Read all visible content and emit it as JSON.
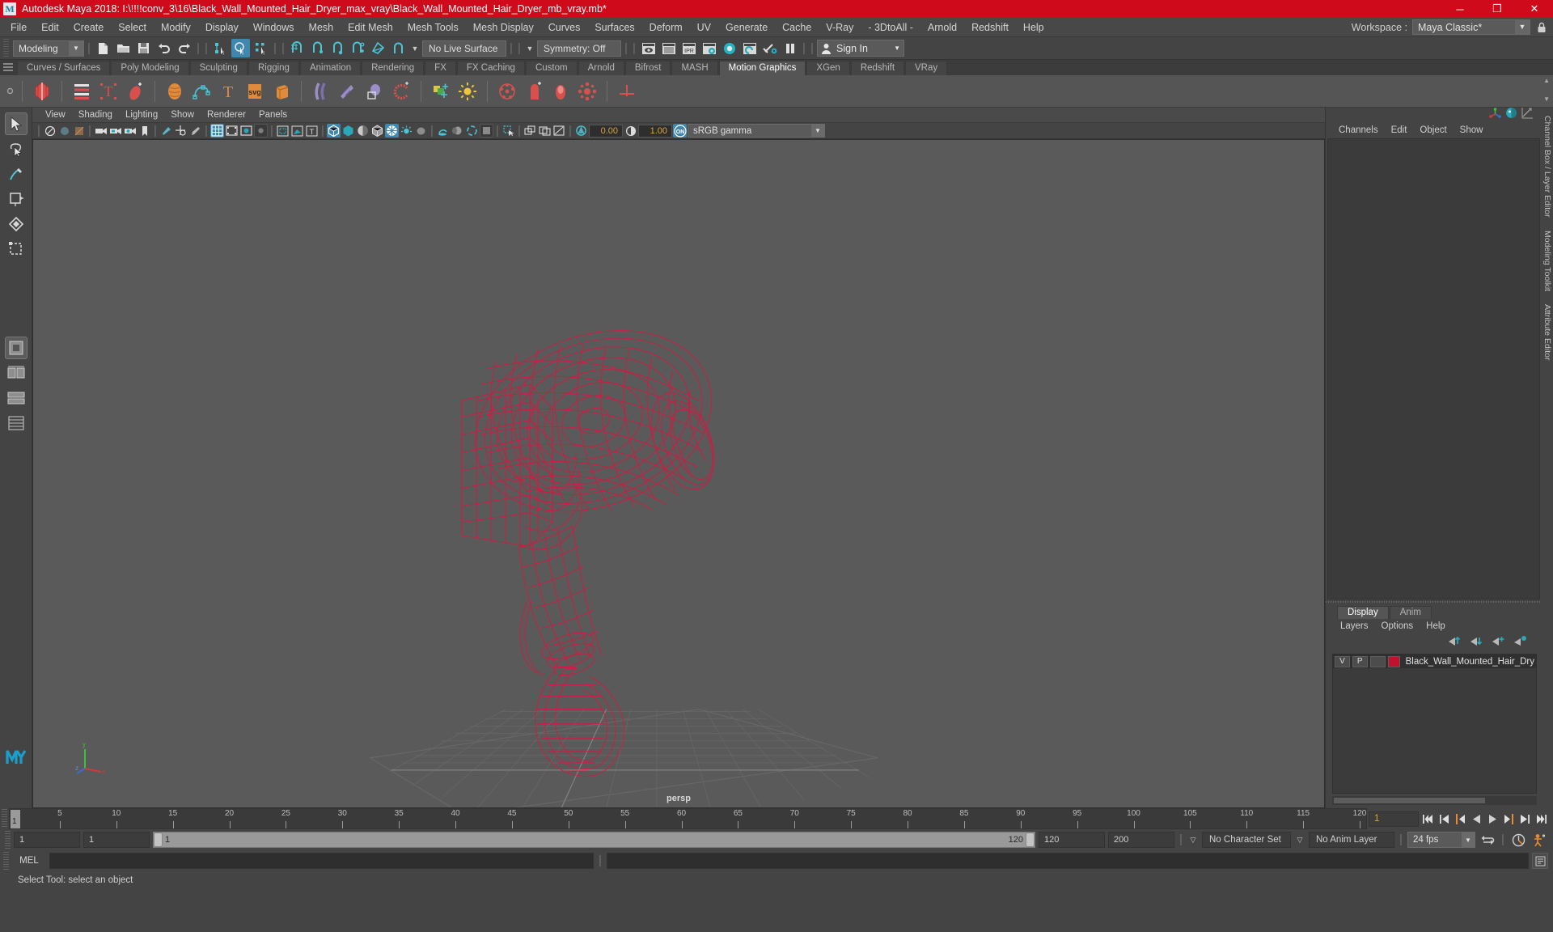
{
  "window": {
    "title": "Autodesk Maya 2018: I:\\!!!!conv_3\\16\\Black_Wall_Mounted_Hair_Dryer_max_vray\\Black_Wall_Mounted_Hair_Dryer_mb_vray.mb*",
    "logo": "M",
    "minimize": "─",
    "maximize": "❐",
    "close": "✕",
    "titlebar_color": "#cf0a1a"
  },
  "menubar": {
    "items": [
      "File",
      "Edit",
      "Create",
      "Select",
      "Modify",
      "Display",
      "Windows",
      "Mesh",
      "Edit Mesh",
      "Mesh Tools",
      "Mesh Display",
      "Curves",
      "Surfaces",
      "Deform",
      "UV",
      "Generate",
      "Cache",
      "V-Ray",
      "- 3DtoAll -",
      "Arnold",
      "Redshift",
      "Help"
    ],
    "workspace_label": "Workspace :",
    "workspace_value": "Maya Classic*",
    "lock_icon": "lock-icon"
  },
  "statusbar": {
    "menuset": "Modeling",
    "file_icons": [
      "new-scene-icon",
      "open-scene-icon",
      "save-scene-icon",
      "undo-icon",
      "redo-icon"
    ],
    "select_mode_icons": [
      "select-by-hierarchy-icon",
      "select-by-object-icon",
      "select-by-component-icon"
    ],
    "snap_icons": [
      "snap-to-grid-icon",
      "snap-to-curve-icon",
      "snap-to-point-icon",
      "snap-to-projected-center-icon",
      "snap-to-view-plane-icon",
      "make-live-icon"
    ],
    "live_surface": "No Live Surface",
    "symmetry": "Symmetry: Off",
    "render_icons": [
      "render-current-frame-icon",
      "ipr-render-icon",
      "render-settings-icon",
      "hypershade-icon",
      "render-view-icon",
      "render-sequence-icon",
      "pause-render-icon"
    ],
    "signin_label": "Sign In",
    "signin_icon": "user-icon"
  },
  "shelf": {
    "tabs": [
      "Curves / Surfaces",
      "Poly Modeling",
      "Sculpting",
      "Rigging",
      "Animation",
      "Rendering",
      "FX",
      "FX Caching",
      "Custom",
      "Arnold",
      "Bifrost",
      "MASH",
      "Motion Graphics",
      "XGen",
      "Redshift",
      "VRay"
    ],
    "active_tab": "Motion Graphics",
    "icons": [
      "mash-network-icon",
      "mash-menu-icon",
      "mash-text-icon",
      "mash-trails-icon",
      "mash-volume-icon",
      "mash-curve-icon",
      "mash-type-icon",
      "svg-icon",
      "mash-extrude-icon",
      "mash-dynamics-icon",
      "mash-flight-icon",
      "mash-orient-icon",
      "mash-curl-icon",
      "mash-color-icon",
      "mash-world-icon",
      "mash-replicator-icon",
      "mash-distribute-icon",
      "mash-merge-icon",
      "mash-explode-icon",
      "mash-align-icon"
    ]
  },
  "toolbox": {
    "tools": [
      "select-tool",
      "lasso-select-tool",
      "paint-select-tool",
      "move-tool",
      "rotate-tool",
      "scale-tool"
    ],
    "layout_tools": [
      "single-pane-layout-icon",
      "two-pane-layout-icon",
      "three-pane-layout-icon",
      "four-pane-layout-icon"
    ],
    "app_logo": "M"
  },
  "viewport": {
    "menus": [
      "View",
      "Shading",
      "Lighting",
      "Show",
      "Renderer",
      "Panels"
    ],
    "toolbar_icons": [
      "select-camera-icon",
      "lock-camera-icon",
      "camera-attributes-icon",
      "bookmark-icon",
      "image-plane-icon",
      "two-d-pan-zoom-icon",
      "grease-pencil-icon",
      "grid-icon",
      "film-gate-icon",
      "resolution-gate-icon",
      "gate-mask-icon",
      "xray-icon",
      "xray-joints-icon",
      "texture-icon",
      "wireframe-icon",
      "smooth-shade-icon",
      "flat-shade-icon",
      "wireframe-on-shaded-icon",
      "textured-icon",
      "use-default-light-icon",
      "shadows-icon",
      "screen-space-ao-icon",
      "motion-blur-icon",
      "multisample-aa-icon",
      "depth-of-field-icon",
      "isolate-select-icon",
      "display-layer-icon",
      "panel-zoom-icon",
      "exposure-icon"
    ],
    "exposure_value": "0.00",
    "gamma_value": "1.00",
    "color_management": "sRGB gamma",
    "color_mgmt_toggle": "ON",
    "camera_label": "persp",
    "axis_labels": [
      "y",
      "x",
      "z"
    ],
    "object_color": "#e0133f",
    "bg_color": "#5a5a5a"
  },
  "right_panel": {
    "quick_icons": [
      "axis-gizmo-icon",
      "render-globals-icon",
      "graph-editor-icon"
    ],
    "menus": [
      "Channels",
      "Edit",
      "Object",
      "Show"
    ],
    "vertical_tabs": [
      "Channel Box / Layer Editor",
      "Modeling Toolkit",
      "Attribute Editor"
    ]
  },
  "layer_editor": {
    "tabs": [
      "Display",
      "Anim"
    ],
    "active_tab": "Display",
    "menus": [
      "Layers",
      "Options",
      "Help"
    ],
    "buttons": [
      "move-layer-up-icon",
      "move-layer-down-icon",
      "new-layer-icon",
      "new-layer-from-selected-icon"
    ],
    "layers": [
      {
        "visibility": "V",
        "playback": "P",
        "shading": "",
        "color": "#c0112e",
        "name": "Black_Wall_Mounted_Hair_Dry"
      }
    ]
  },
  "timeslider": {
    "current_frame_left": "1",
    "start_frame": "1",
    "cursor_frame": "1",
    "ticks": [
      5,
      10,
      15,
      20,
      25,
      30,
      35,
      40,
      45,
      50,
      55,
      60,
      65,
      70,
      75,
      80,
      85,
      90,
      95,
      100,
      105,
      110,
      115,
      120
    ],
    "current_frame_field": "1",
    "playback_buttons": [
      "go-to-start-icon",
      "step-back-keyframe-icon",
      "step-back-frame-icon",
      "play-backwards-icon",
      "play-forwards-icon",
      "step-forward-frame-icon",
      "step-forward-keyframe-icon",
      "go-to-end-icon"
    ]
  },
  "range_row": {
    "anim_start": "1",
    "range_start": "1",
    "slider_min_label": "1",
    "slider_max_label": "120",
    "range_end": "120",
    "anim_end": "200",
    "character_set": "No Character Set",
    "anim_layer": "No Anim Layer",
    "fps": "24 fps",
    "loop_icon": "loop-playback-icon",
    "auto_key_icon": "auto-keyframe-icon",
    "prefs_icon": "animation-preferences-icon"
  },
  "command_line": {
    "language": "MEL",
    "input_value": "",
    "output_value": "",
    "script_editor_icon": "script-editor-icon"
  },
  "help_line": {
    "text": "Select Tool: select an object"
  }
}
